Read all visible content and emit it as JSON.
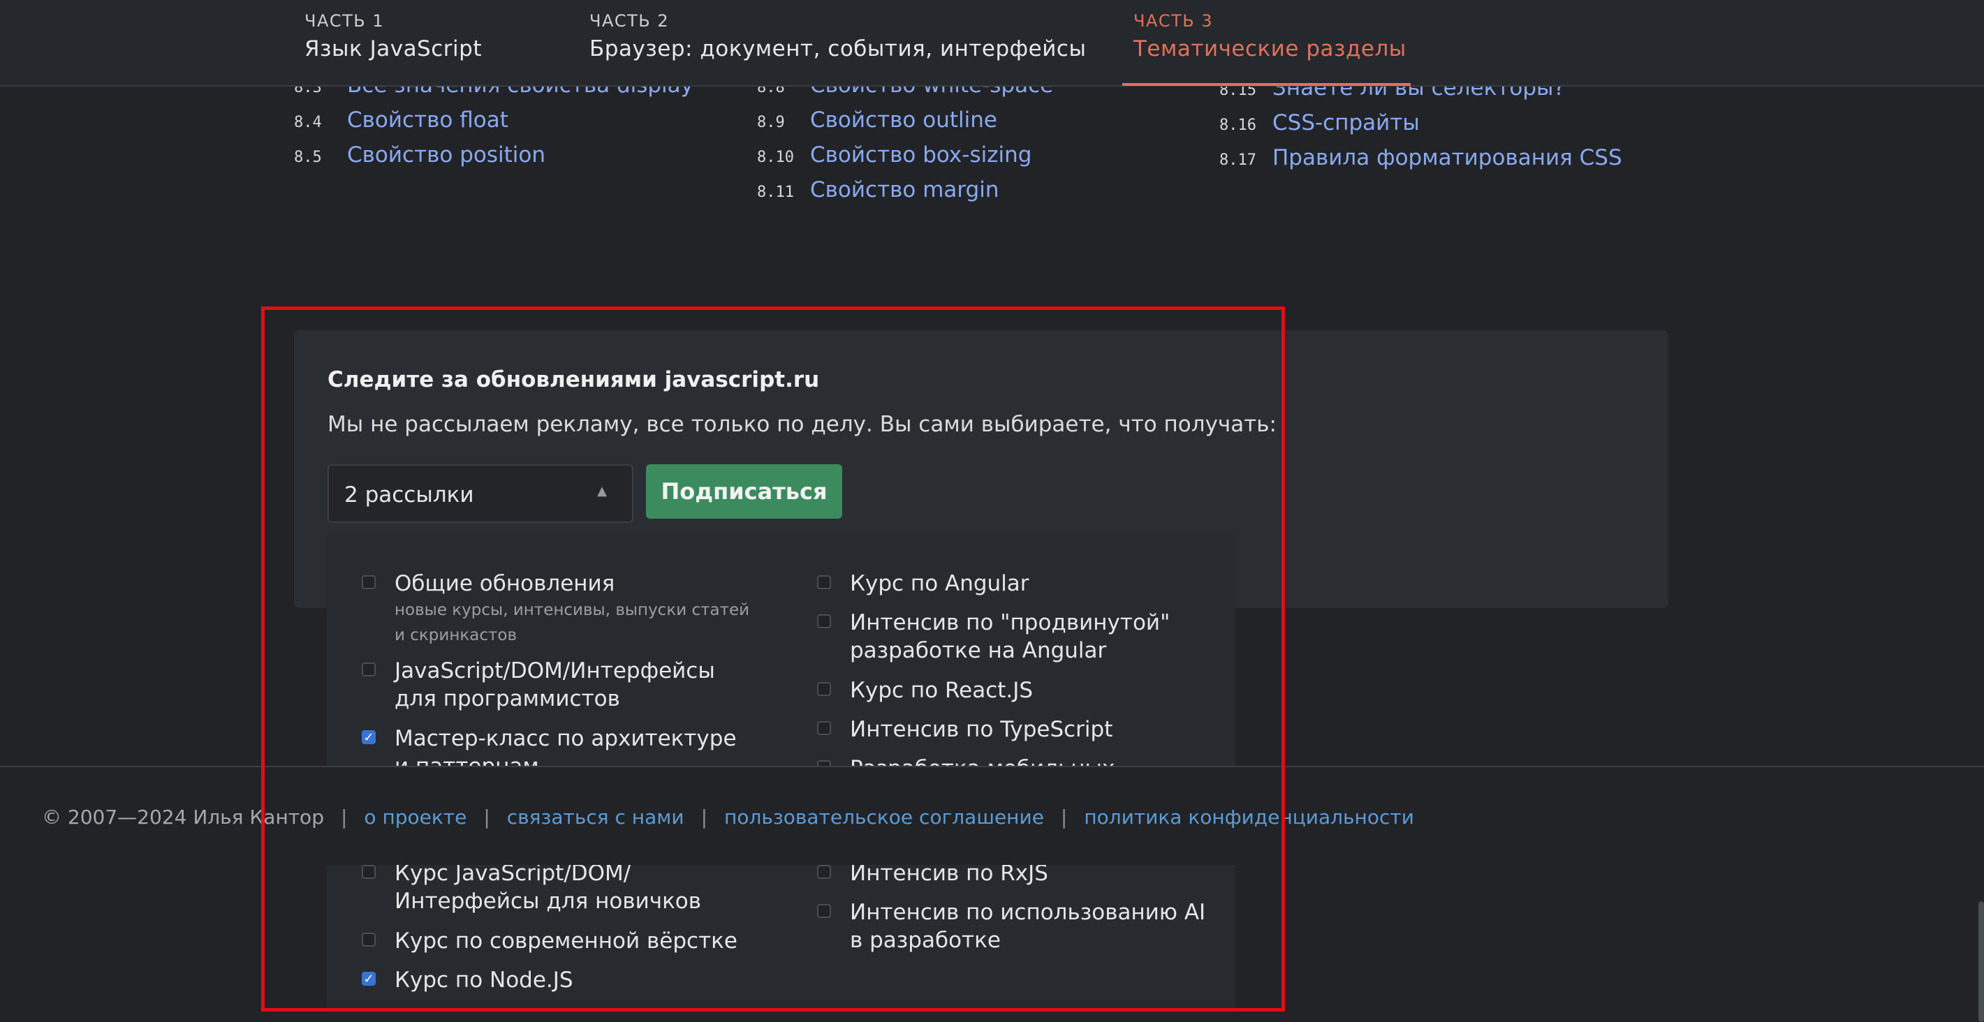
{
  "header": {
    "parts": [
      {
        "num": "ЧАСТЬ 1",
        "title": "Язык JavaScript"
      },
      {
        "num": "ЧАСТЬ 2",
        "title": "Браузер: документ, события, интерфейсы"
      },
      {
        "num": "ЧАСТЬ 3",
        "title": "Тематические разделы"
      }
    ],
    "active_index": 2
  },
  "toc": {
    "col1": [
      {
        "n": "8.3",
        "label": "Все значения свойства display"
      },
      {
        "n": "8.4",
        "label": "Свойство float"
      },
      {
        "n": "8.5",
        "label": "Свойство position"
      }
    ],
    "col2": [
      {
        "n": "8.8",
        "label": "Свойство white-space"
      },
      {
        "n": "8.9",
        "label": "Свойство outline"
      },
      {
        "n": "8.10",
        "label": "Свойство box-sizing"
      },
      {
        "n": "8.11",
        "label": "Свойство margin"
      }
    ],
    "col3": [
      {
        "n": "8.15",
        "label": "Знаете ли вы селекторы?"
      },
      {
        "n": "8.16",
        "label": "CSS-спрайты"
      },
      {
        "n": "8.17",
        "label": "Правила форматирования CSS"
      }
    ]
  },
  "subscribe": {
    "title": "Следите за обновлениями javascript.ru",
    "description": "Мы не рассылаем рекламу, все только по делу. Вы сами выбираете, что получать:",
    "select_value": "2 рассылки",
    "button_label": "Подписаться"
  },
  "options_left": [
    {
      "label": "Общие обновления",
      "sub": "новые курсы, интенсивы, выпуски статей и скринкастов",
      "checked": false
    },
    {
      "label": "JavaScript/DOM/Интерфейсы для программистов",
      "checked": false
    },
    {
      "label": "Мастер-класс по архитектуре и паттернам",
      "checked": true
    },
    {
      "label": "Курс JavaScript/DOM/Интерфейсы для новичков",
      "checked": false
    },
    {
      "label": "Курс по современной вёрстке",
      "checked": false
    },
    {
      "label": "Курс по Node.JS",
      "checked": true
    }
  ],
  "options_right": [
    {
      "label": "Курс по Angular",
      "checked": false
    },
    {
      "label": "Интенсив по \"продвинутой\" разработке на Angular",
      "checked": false
    },
    {
      "label": "Курс по React.JS",
      "checked": false
    },
    {
      "label": "Интенсив по TypeScript",
      "checked": false
    },
    {
      "label": "Разработка мобильных",
      "checked": false
    },
    {
      "label": "Интенсив по RxJS",
      "checked": false
    },
    {
      "label": "Интенсив по использованию AI в разработке",
      "checked": false
    }
  ],
  "footer": {
    "copyright": "© 2007—2024  Илья Кантор",
    "sep": "|",
    "links": [
      "о проекте",
      "связаться с нами",
      "пользовательское соглашение",
      "политика конфиденциальности"
    ]
  },
  "colors": {
    "accent": "#e3705c",
    "link": "#8aa9f0",
    "button": "#3c8b5e",
    "checkbox_checked": "#3a73d6",
    "highlight": "#e10e17"
  }
}
